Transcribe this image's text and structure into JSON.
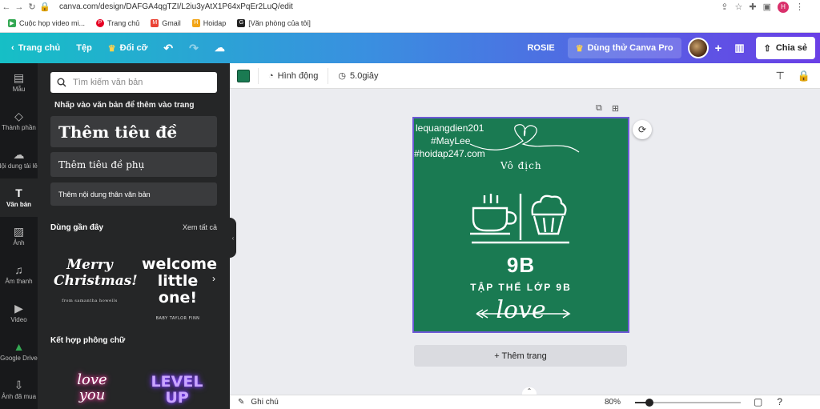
{
  "browser": {
    "url": "canva.com/design/DAFGA4qgTZI/L2iu3yAtX1P64xPqEr2LuQ/edit",
    "profile_initial": "H",
    "bookmarks": [
      {
        "label": "Cuộc họp video mi...",
        "icon": "meet-icon",
        "color": "#34a853"
      },
      {
        "label": "Trang chủ",
        "icon": "pinterest-icon",
        "color": "#e60023"
      },
      {
        "label": "Gmail",
        "icon": "gmail-icon",
        "color": "#ea4335"
      },
      {
        "label": "Hoidap",
        "icon": "hoidap-icon",
        "color": "#f2a516"
      },
      {
        "label": "[Văn phòng của tôi]",
        "icon": "office-icon",
        "color": "#222222"
      }
    ]
  },
  "topbar": {
    "home": "Trang chủ",
    "file": "Tệp",
    "resize": "Đổi cỡ",
    "user_name": "ROSIE",
    "pro": "Dùng thử Canva Pro",
    "share": "Chia sẻ"
  },
  "rail": {
    "items": [
      {
        "label": "Mẫu",
        "icon": "template-icon"
      },
      {
        "label": "Thành phần",
        "icon": "elements-icon"
      },
      {
        "label": "Nội dung tải lên",
        "icon": "upload-icon"
      },
      {
        "label": "Văn bản",
        "icon": "text-icon"
      },
      {
        "label": "Ảnh",
        "icon": "photo-icon"
      },
      {
        "label": "Âm thanh",
        "icon": "audio-icon"
      },
      {
        "label": "Video",
        "icon": "video-icon"
      },
      {
        "label": "Google Drive",
        "icon": "google-drive-icon"
      },
      {
        "label": "Ảnh đã mua",
        "icon": "purchased-icon"
      }
    ]
  },
  "panel": {
    "search_placeholder": "Tìm kiếm văn bản",
    "hint": "Nhấp vào văn bản để thêm vào trang",
    "add_heading": "Thêm tiêu đề",
    "add_subheading": "Thêm tiêu đề phụ",
    "add_body": "Thêm nội dung thân văn bản",
    "recent_title": "Dùng gần đây",
    "see_all": "Xem tất cả",
    "merry_text": "Merry Christmas!",
    "merry_sub": "from samantha howells",
    "welcome_text": "welcome little one!",
    "welcome_sub": "BABY TAYLOR FINN",
    "combo_title": "Kết hợp phông chữ",
    "combo1": "love you",
    "combo2": "LEVEL UP"
  },
  "editor": {
    "color": "#1a7a52",
    "animate": "Hình động",
    "duration": "5.0giây"
  },
  "design": {
    "line1": "lequangdien201",
    "line2": "#MayLee",
    "line3": "#hoidap247.com",
    "vodich": "Vô địch",
    "class_name": "9B",
    "group": "TẬP THỂ LỚP 9B",
    "love": "love",
    "background": "#1a7a52"
  },
  "add_page": "+ Thêm trang",
  "footer": {
    "notes": "Ghi chú",
    "zoom": "80%",
    "zoom_level": 0.14
  }
}
